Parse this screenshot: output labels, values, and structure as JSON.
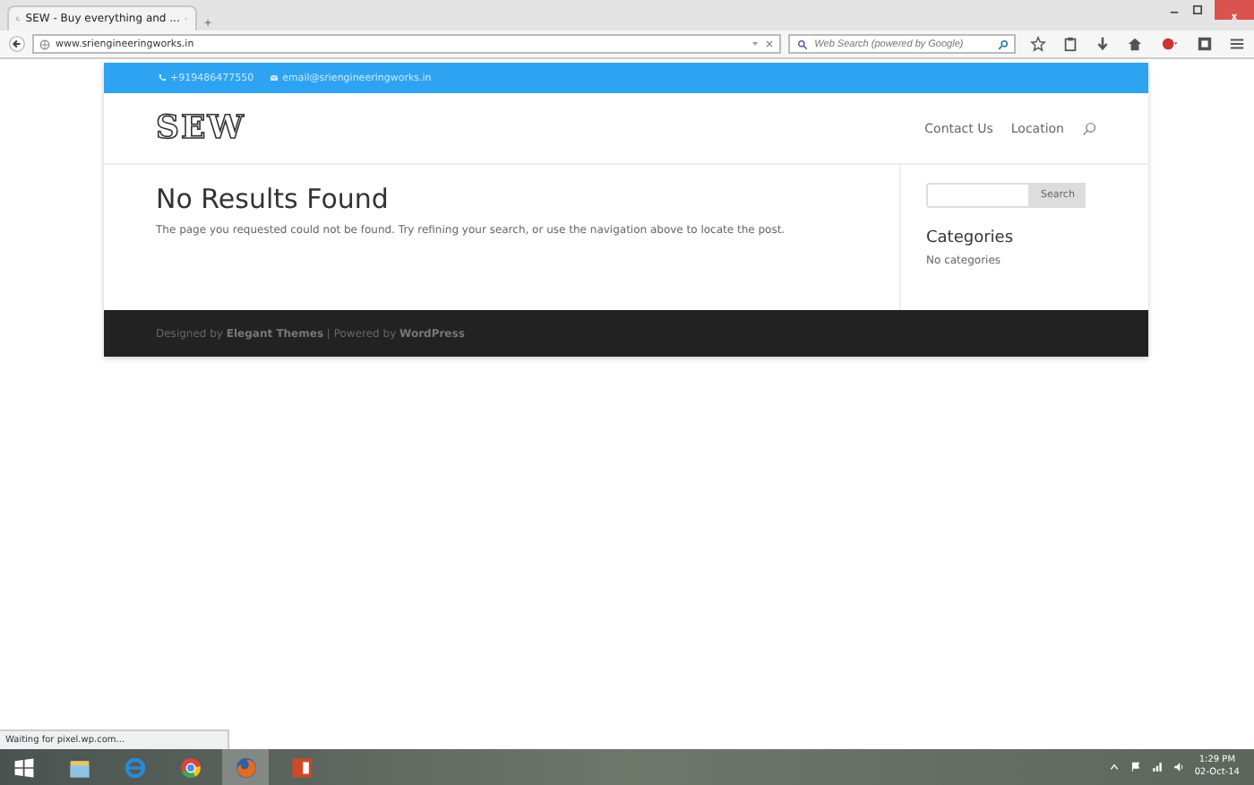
{
  "browser": {
    "tabs": [
      {
        "title": "SEW - Buy everything and ...",
        "selected": true,
        "loading": true
      }
    ],
    "new_tab": "+",
    "address": "www.sriengineeringworks.in",
    "search": {
      "placeholder": "Web Search (powered by Google)"
    },
    "status": "Waiting for pixel.wp.com..."
  },
  "site": {
    "top_bar": {
      "phone": "+919486477550",
      "email": "email@sriengineeringworks.in"
    },
    "logo": "SEW",
    "nav": [
      "Contact Us",
      "Location"
    ],
    "heading": "No Results Found",
    "message": "The page you requested could not be found. Try refining your search, or use the navigation above to locate the post.",
    "sidebar": {
      "search_button": "Search",
      "categories_title": "Categories",
      "categories_empty": "No categories"
    },
    "footer": "Designed by **Elegant Themes** | Powered by **WordPress**"
  },
  "taskbar": {
    "apps": [
      {
        "kind": "start",
        "selected": false
      },
      {
        "kind": "folder",
        "selected": false
      },
      {
        "kind": "ie",
        "selected": false
      },
      {
        "kind": "chrome",
        "selected": false
      },
      {
        "kind": "firefox",
        "selected": true
      },
      {
        "kind": "powerpoint",
        "selected": false
      }
    ],
    "time": "1:29 PM",
    "date": "02-Oct-14"
  }
}
